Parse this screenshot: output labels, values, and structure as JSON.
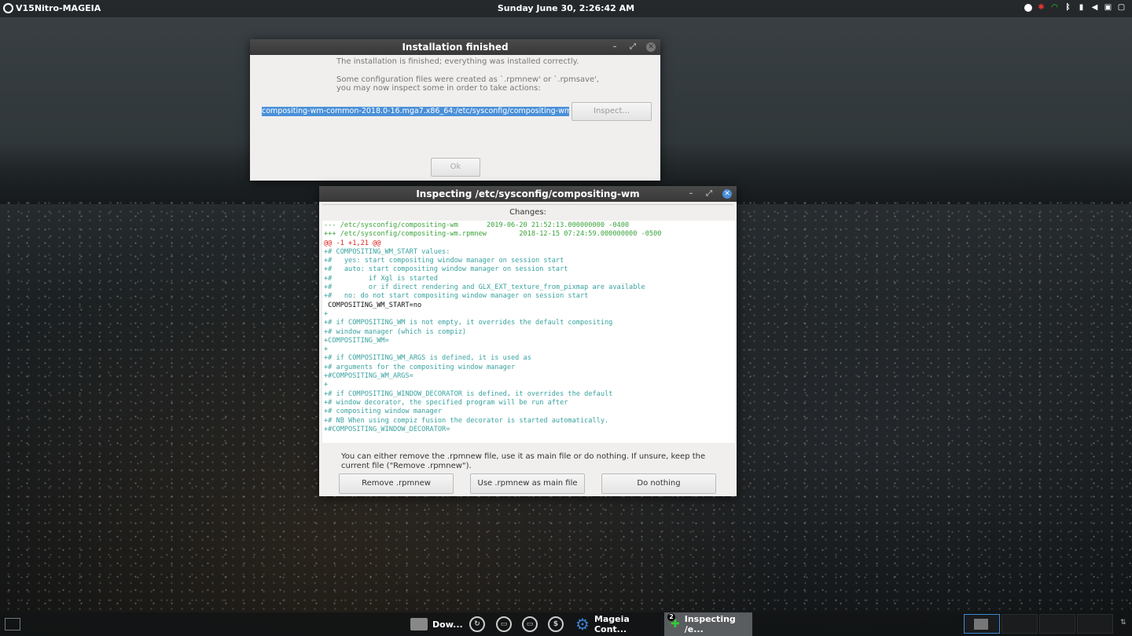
{
  "topbar": {
    "hostname": "V15Nitro-MAGEIA",
    "clock": "Sunday June 30,  2:26:42 AM",
    "tray_icons": [
      "record-icon",
      "network-error-icon",
      "wifi-icon",
      "bluetooth-icon",
      "battery-icon",
      "volume-icon",
      "sd-card-icon",
      "user-icon"
    ]
  },
  "install_dialog": {
    "title": "Installation finished",
    "message1": "The installation is finished; everything was installed correctly.",
    "message2": "Some configuration files were created as `.rpmnew' or `.rpmsave',",
    "message3": "you may now inspect some in order to take actions:",
    "selected_file": "compositing-wm-common-2018.0-16.mga7.x86_64:/etc/sysconfig/compositing-wm",
    "inspect_label": "Inspect...",
    "ok_label": "Ok"
  },
  "inspect_dialog": {
    "title": "Inspecting /etc/sysconfig/compositing-wm",
    "changes_label": "Changes:",
    "diff_lines": [
      {
        "kind": "hdr",
        "text": "--- /etc/sysconfig/compositing-wm       2019-06-20 21:52:13.000000000 -0400"
      },
      {
        "kind": "hdr",
        "text": "+++ /etc/sysconfig/compositing-wm.rpmnew        2018-12-15 07:24:59.000000000 -0500"
      },
      {
        "kind": "hunk",
        "text": "@@ -1 +1,21 @@"
      },
      {
        "kind": "add",
        "text": "+# COMPOSITING_WM_START values:"
      },
      {
        "kind": "add",
        "text": "+#   yes: start compositing window manager on session start"
      },
      {
        "kind": "add",
        "text": "+#   auto: start compositing window manager on session start"
      },
      {
        "kind": "add",
        "text": "+#         if Xgl is started"
      },
      {
        "kind": "add",
        "text": "+#         or if direct rendering and GLX_EXT_texture_from_pixmap are available"
      },
      {
        "kind": "add",
        "text": "+#   no: do not start compositing window manager on session start"
      },
      {
        "kind": "ctx",
        "text": " COMPOSITING_WM_START=no"
      },
      {
        "kind": "add",
        "text": "+"
      },
      {
        "kind": "add",
        "text": "+# if COMPOSITING_WM is not empty, it overrides the default compositing"
      },
      {
        "kind": "add",
        "text": "+# window manager (which is compiz)"
      },
      {
        "kind": "add",
        "text": "+COMPOSITING_WM="
      },
      {
        "kind": "add",
        "text": "+"
      },
      {
        "kind": "add",
        "text": "+# if COMPOSITING_WM_ARGS is defined, it is used as"
      },
      {
        "kind": "add",
        "text": "+# arguments for the compositing window manager"
      },
      {
        "kind": "add",
        "text": "+#COMPOSITING_WM_ARGS="
      },
      {
        "kind": "add",
        "text": "+"
      },
      {
        "kind": "add",
        "text": "+# if COMPOSITING_WINDOW_DECORATOR is defined, it overrides the default"
      },
      {
        "kind": "add",
        "text": "+# window decorator, the specified program will be run after"
      },
      {
        "kind": "add",
        "text": "+# compositing window manager"
      },
      {
        "kind": "add",
        "text": "+# NB When using compiz fusion the decorator is started automatically."
      },
      {
        "kind": "add",
        "text": "+#COMPOSITING_WINDOW_DECORATOR="
      }
    ],
    "note": "You can either remove the .rpmnew file, use it as main file or do nothing. If unsure, keep the current file (\"Remove .rpmnew\").",
    "btn_remove": "Remove .rpmnew",
    "btn_use": "Use .rpmnew as main file",
    "btn_nothing": "Do nothing"
  },
  "taskbar": {
    "item_downloads": "Dow...",
    "item_mcc": "Mageia Cont...",
    "item_inspect": "Inspecting /e...",
    "inspect_badge": "2",
    "quick_icon_dollar": "$"
  }
}
